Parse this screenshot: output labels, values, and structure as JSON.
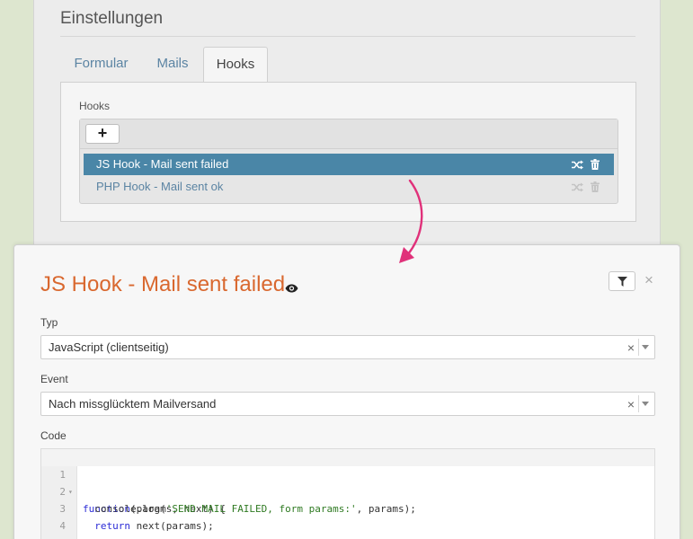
{
  "settings": {
    "title": "Einstellungen",
    "tabs": [
      {
        "label": "Formular",
        "active": false
      },
      {
        "label": "Mails",
        "active": false
      },
      {
        "label": "Hooks",
        "active": true
      }
    ],
    "hooks_label": "Hooks",
    "add_label": "+",
    "hooks": [
      {
        "label": "JS Hook - Mail sent failed",
        "selected": true
      },
      {
        "label": "PHP Hook - Mail sent ok",
        "selected": false
      }
    ]
  },
  "modal": {
    "title": "JS Hook - Mail sent failed",
    "close_label": "×",
    "type_field": {
      "label": "Typ",
      "value": "JavaScript (clientseitig)",
      "clear": "×"
    },
    "event_field": {
      "label": "Event",
      "value": "Nach missglücktem Mailversand",
      "clear": "×"
    },
    "code_label": "Code",
    "code_lines": [
      {
        "num": "1",
        "text": "function(params, next) {"
      },
      {
        "num": "2",
        "text": "  console.log('SEND MAIL FAILED, form params:', params);"
      },
      {
        "num": "3",
        "text": "  return next(params);"
      },
      {
        "num": "4",
        "text": "}"
      }
    ]
  },
  "colors": {
    "background": "#dde6cf",
    "accent_title": "#d9682f",
    "selection": "#4a86a7",
    "link": "#5b84a3",
    "arrow": "#e0317a"
  },
  "icons": [
    "plus-icon",
    "shuffle-icon",
    "trash-icon",
    "eye-icon",
    "filter-icon",
    "close-icon",
    "chevron-down-icon",
    "arrow-icon"
  ]
}
